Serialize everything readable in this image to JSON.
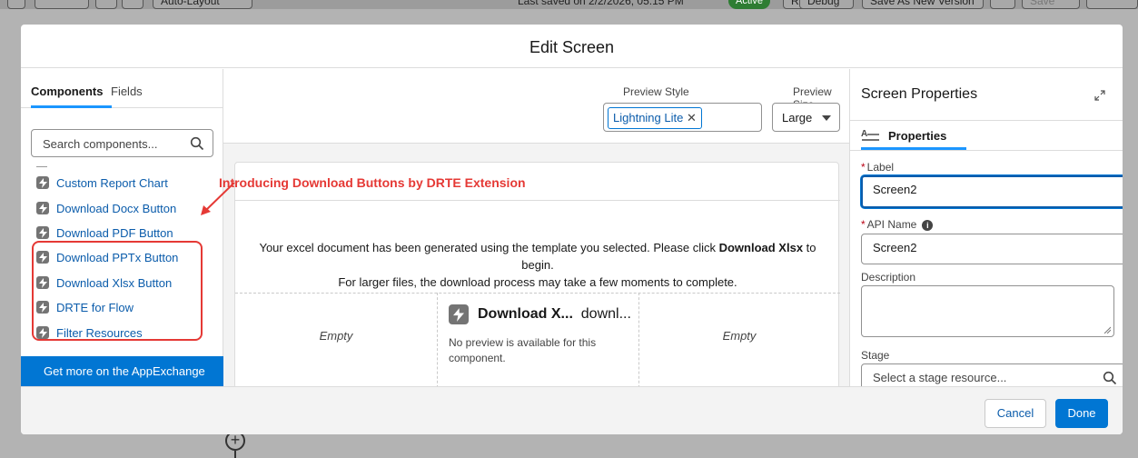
{
  "toolbar": {
    "layout_label": "Auto-Layout",
    "last_saved": "Last saved on 2/2/2026, 05:15 PM",
    "status": "Active",
    "run": "Run",
    "debug": "Debug",
    "save_as_new": "Save As New Version",
    "save": "Save"
  },
  "modal": {
    "title": "Edit Screen",
    "cancel": "Cancel",
    "done": "Done"
  },
  "left": {
    "tabs": [
      "Components",
      "Fields"
    ],
    "search_placeholder": "Search components...",
    "items": [
      {
        "label": "Custom Report Chart"
      },
      {
        "label": "Download Docx Button"
      },
      {
        "label": "Download PDF Button"
      },
      {
        "label": "Download PPTx Button"
      },
      {
        "label": "Download Xlsx Button"
      },
      {
        "label": "DRTE for Flow"
      },
      {
        "label": "Filter Resources"
      }
    ],
    "appexchange": "Get more on the AppExchange"
  },
  "annotation": {
    "text": "Introducing Download Buttons by DRTE Extension",
    "color": "#e53935"
  },
  "center": {
    "preview_style_label": "Preview Style",
    "preview_style_value": "Lightning Lite",
    "preview_size_label": "Preview Size",
    "preview_size_value": "Large",
    "message_before": "Your excel document has been generated using the template you selected. Please click ",
    "message_bold": "Download Xlsx",
    "message_after": " to begin.",
    "message_line2": "For larger files, the download process may take a few moments to complete.",
    "empty_left": "Empty",
    "empty_right": "Empty",
    "component_title": "Download X...",
    "component_subtitle": "downl...",
    "component_note": "No preview is available for this component."
  },
  "right": {
    "title": "Screen Properties",
    "tab": "Properties",
    "label_field": "Label",
    "label_value": "Screen2",
    "api_field": "API Name",
    "api_value": "Screen2",
    "description_field": "Description",
    "stage_field": "Stage",
    "stage_placeholder": "Select a stage resource..."
  },
  "colors": {
    "brand": "#0176d3",
    "link": "#0b5cab",
    "highlight": "#e53935"
  }
}
